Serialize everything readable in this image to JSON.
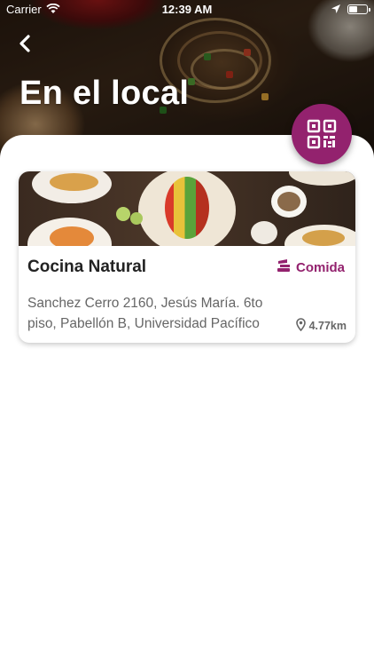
{
  "status_bar": {
    "carrier": "Carrier",
    "time": "12:39 AM"
  },
  "header": {
    "title": "En el local",
    "back_icon": "chevron-left-icon",
    "qr_icon": "qr-code-icon"
  },
  "colors": {
    "accent": "#93226e",
    "text_dark": "#222222",
    "text_muted": "#666666"
  },
  "places": [
    {
      "name": "Cocina Natural",
      "category": "Comida",
      "category_icon": "food-tray-icon",
      "address": "Sanchez Cerro 2160, Jesús María. 6to piso, Pabellón B, Universidad Pacífico",
      "distance": "4.77km"
    }
  ]
}
